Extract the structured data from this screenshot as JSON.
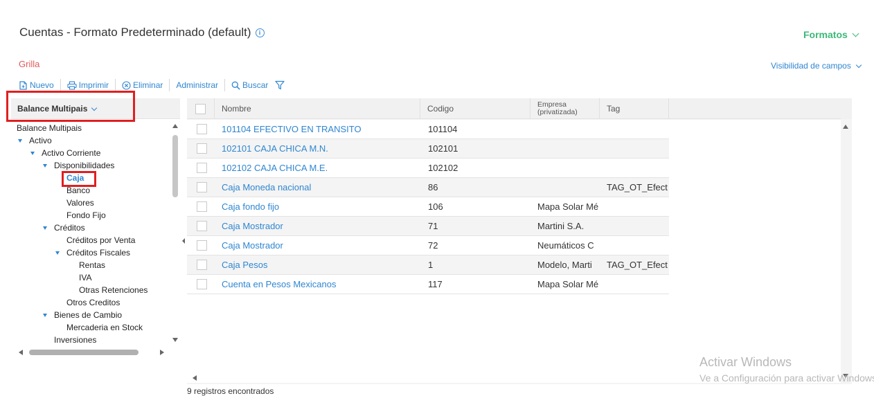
{
  "header": {
    "title": "Cuentas - Formato Predeterminado (default)",
    "info_icon": "info-icon",
    "formatos_label": "Formatos"
  },
  "view": {
    "label": "Grilla",
    "field_visibility_label": "Visibilidad de campos"
  },
  "toolbar": {
    "new_label": "Nuevo",
    "print_label": "Imprimir",
    "delete_label": "Eliminar",
    "admin_label": "Administrar",
    "search_label": "Buscar",
    "filter_icon": "filter-icon"
  },
  "tree": {
    "selector_label": "Balance Multipais",
    "selected": "Caja",
    "nodes": [
      {
        "label": "Balance Multipais",
        "level": 0,
        "expanded": null
      },
      {
        "label": "Activo",
        "level": 1,
        "expanded": true
      },
      {
        "label": "Activo Corriente",
        "level": 2,
        "expanded": true
      },
      {
        "label": "Disponibilidades",
        "level": 3,
        "expanded": true
      },
      {
        "label": "Caja",
        "level": 4,
        "expanded": null
      },
      {
        "label": "Banco",
        "level": 4,
        "expanded": null
      },
      {
        "label": "Valores",
        "level": 4,
        "expanded": null
      },
      {
        "label": "Fondo Fijo",
        "level": 4,
        "expanded": null
      },
      {
        "label": "Créditos",
        "level": 3,
        "expanded": true
      },
      {
        "label": "Créditos por Venta",
        "level": 4,
        "expanded": null
      },
      {
        "label": "Créditos Fiscales",
        "level": 4,
        "expanded": true
      },
      {
        "label": "Rentas",
        "level": 5,
        "expanded": null
      },
      {
        "label": "IVA",
        "level": 5,
        "expanded": null
      },
      {
        "label": "Otras Retenciones",
        "level": 5,
        "expanded": null
      },
      {
        "label": "Otros Creditos",
        "level": 4,
        "expanded": null
      },
      {
        "label": "Bienes de Cambio",
        "level": 3,
        "expanded": true
      },
      {
        "label": "Mercaderia en Stock",
        "level": 4,
        "expanded": null
      },
      {
        "label": "Inversiones",
        "level": 3,
        "expanded": null
      }
    ]
  },
  "grid": {
    "columns": {
      "name": "Nombre",
      "code": "Codigo",
      "company_line1": "Empresa",
      "company_line2": "(privatizada)",
      "tag": "Tag"
    },
    "rows": [
      {
        "name": "101104 EFECTIVO EN TRANSITO",
        "code": "101104",
        "company": "",
        "tag": ""
      },
      {
        "name": "102101 CAJA CHICA M.N.",
        "code": "102101",
        "company": "",
        "tag": ""
      },
      {
        "name": "102102 CAJA CHICA M.E.",
        "code": "102102",
        "company": "",
        "tag": ""
      },
      {
        "name": "Caja Moneda nacional",
        "code": "86",
        "company": "",
        "tag": "TAG_OT_Efect"
      },
      {
        "name": "Caja fondo fijo",
        "code": "106",
        "company": "Mapa Solar Mé",
        "tag": ""
      },
      {
        "name": "Caja Mostrador",
        "code": "71",
        "company": "Martini S.A.",
        "tag": ""
      },
      {
        "name": "Caja Mostrador",
        "code": "72",
        "company": "Neumáticos C",
        "tag": ""
      },
      {
        "name": "Caja Pesos",
        "code": "1",
        "company": "Modelo, Marti",
        "tag": "TAG_OT_Efect"
      },
      {
        "name": "Cuenta en Pesos Mexicanos",
        "code": "117",
        "company": "Mapa Solar Mé",
        "tag": ""
      }
    ],
    "footer": "9 registros encontrados"
  },
  "watermark": {
    "line1": "Activar Windows",
    "line2": "Ve a Configuración para activar Windows."
  },
  "colors": {
    "accent_blue": "#2f86d0",
    "accent_green": "#3cb878",
    "view_red": "#e05a5a",
    "highlight_red": "#e01f1f"
  }
}
